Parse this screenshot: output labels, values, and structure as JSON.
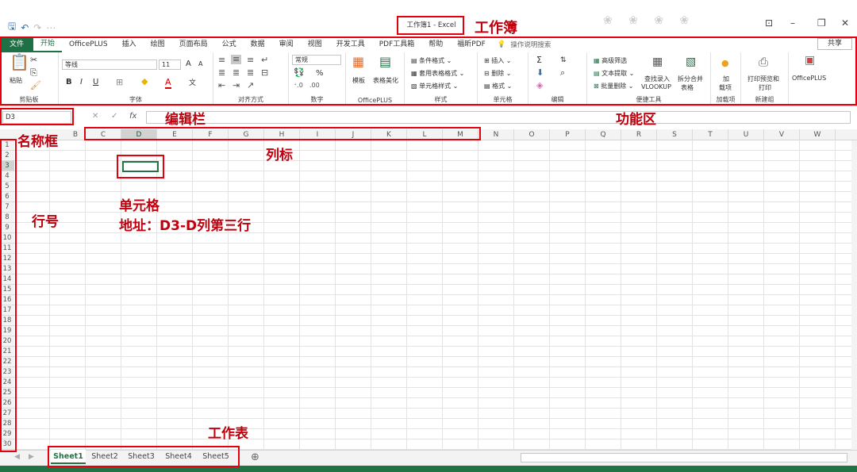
{
  "qat": {
    "save_icon": "save-icon",
    "undo_icon": "undo-icon",
    "redo_icon": "redo-icon"
  },
  "window": {
    "title": "工作簿1  -  Excel"
  },
  "tabs": [
    "文件",
    "开始",
    "OfficePLUS",
    "插入",
    "绘图",
    "页面布局",
    "公式",
    "数据",
    "审阅",
    "视图",
    "开发工具",
    "PDF工具箱",
    "帮助",
    "福昕PDF"
  ],
  "tellme": "操作说明搜索",
  "share": "共享",
  "ribbon": {
    "clipboard": {
      "paste": "粘贴",
      "label": "剪贴板"
    },
    "font": {
      "name": "等线",
      "size": "11",
      "label": "字体",
      "bold": "B",
      "italic": "I",
      "underline": "U",
      "grow": "A",
      "shrink": "A",
      "wen": "文"
    },
    "alignment": {
      "label": "对齐方式"
    },
    "number": {
      "format": "常规",
      "label": "数字",
      "percent": "%"
    },
    "officeplus1": {
      "template": "模板",
      "beautify": "表格美化",
      "label": "OfficePLUS"
    },
    "styles": {
      "cond": "条件格式",
      "table": "套用表格格式",
      "cell": "单元格样式",
      "label": "样式"
    },
    "cells": {
      "insert": "插入",
      "delete": "删除",
      "format": "格式",
      "label": "单元格"
    },
    "editing": {
      "label": "编辑"
    },
    "tools": {
      "filter": "高级筛选",
      "extract": "文本提取",
      "batchdel": "批量删除",
      "vlookup1": "查找录入",
      "vlookup2": "VLOOKUP",
      "split1": "拆分合并",
      "split2": "表格",
      "label": "便捷工具"
    },
    "addin": {
      "l1": "加",
      "l2": "载项",
      "label": "加载项"
    },
    "newgroup": {
      "l1": "打印预览和",
      "l2": "打印",
      "label": "新建组"
    },
    "officeplus2": {
      "label": "OfficePLUS"
    }
  },
  "namebox": "D3",
  "fx": {
    "cancel": "✕",
    "enter": "✓",
    "fx": "fx"
  },
  "columns": [
    "C",
    "D",
    "E",
    "F",
    "G",
    "H",
    "I",
    "J",
    "K",
    "L",
    "M",
    "N",
    "O",
    "P",
    "Q",
    "R",
    "S",
    "T",
    "U",
    "V",
    "W"
  ],
  "partial_col": "B",
  "rows": [
    "1",
    "2",
    "3",
    "4",
    "5",
    "6",
    "7",
    "8",
    "9",
    "10",
    "11",
    "12",
    "13",
    "14",
    "15",
    "16",
    "17",
    "18",
    "19",
    "20",
    "21",
    "22",
    "23",
    "24",
    "25",
    "26",
    "27",
    "28",
    "29",
    "30"
  ],
  "sheets": [
    "Sheet1",
    "Sheet2",
    "Sheet3",
    "Sheet4",
    "Sheet5"
  ],
  "annotations": {
    "workbook": "工作簿",
    "ribbon": "功能区",
    "formula_bar": "编辑栏",
    "name_box": "名称框",
    "col_label": "列标",
    "row_label": "行号",
    "cell": "单元格",
    "cell_addr": "地址：D3-D列第三行",
    "sheet": "工作表"
  },
  "colors": {
    "accent": "#217346",
    "annotation": "#e3000f"
  }
}
